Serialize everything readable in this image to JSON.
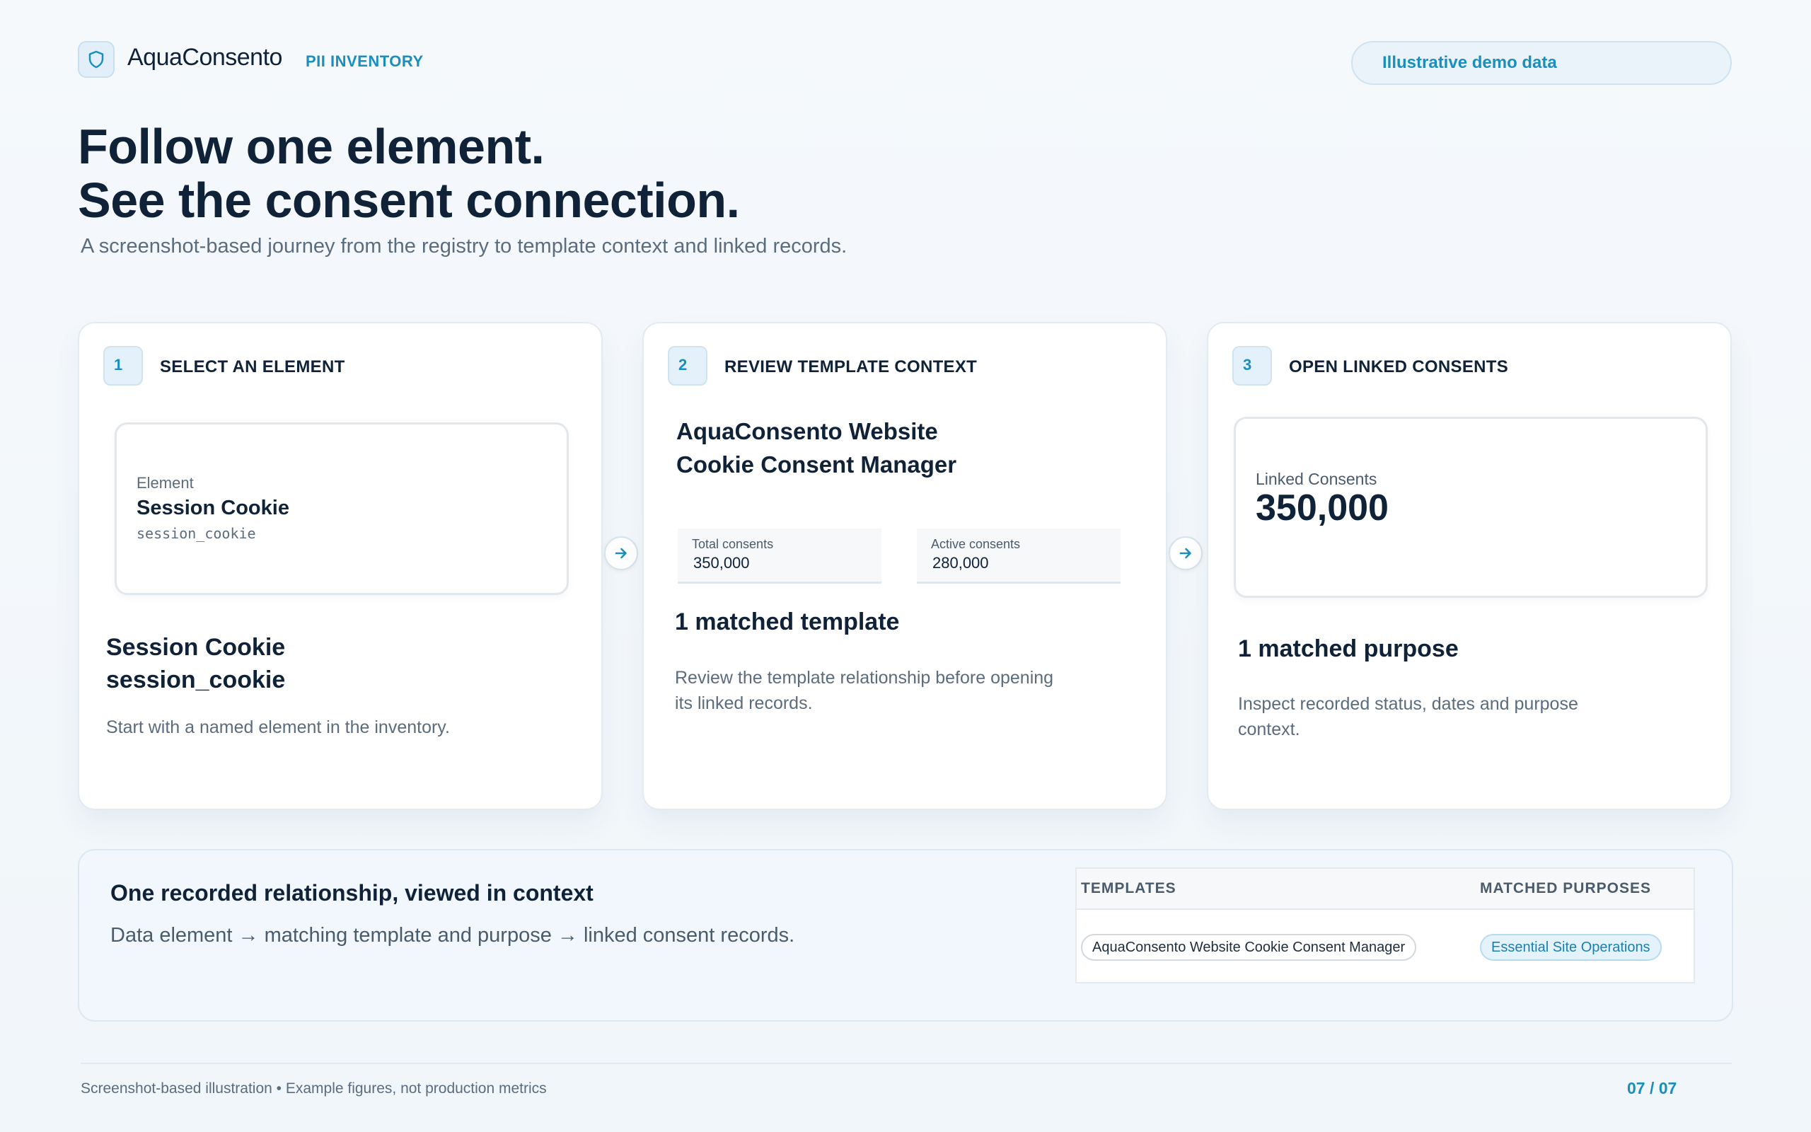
{
  "header": {
    "brand": "AquaConsento",
    "section": "PII INVENTORY",
    "demo_pill": "Illustrative demo data",
    "logo_icon": "shield-icon"
  },
  "hero": {
    "line1": "Follow one element.",
    "line2": "See the consent connection.",
    "subtitle": "A screenshot-based journey from the registry to template context and linked records."
  },
  "steps": [
    {
      "number": "1",
      "title": "SELECT AN ELEMENT",
      "preview": {
        "label": "Element",
        "name": "Session Cookie",
        "code": "session_cookie"
      },
      "heading_line1": "Session Cookie",
      "heading_line2": "session_cookie",
      "description": "Start with a named element in the inventory."
    },
    {
      "number": "2",
      "title": "REVIEW TEMPLATE CONTEXT",
      "template_line1": "AquaConsento Website",
      "template_line2": "Cookie Consent Manager",
      "stats": [
        {
          "label": "Total consents",
          "value": "350,000"
        },
        {
          "label": "Active consents",
          "value": "280,000"
        }
      ],
      "heading": "1 matched template",
      "description_line1": "Review the template relationship before opening",
      "description_line2": "its linked records."
    },
    {
      "number": "3",
      "title": "OPEN LINKED CONSENTS",
      "preview": {
        "label": "Linked Consents",
        "value": "350,000"
      },
      "heading": "1 matched purpose",
      "description_line1": "Inspect recorded status, dates and purpose",
      "description_line2": "context."
    }
  ],
  "connectors": [
    "arrow-right-icon",
    "arrow-right-icon"
  ],
  "bottom": {
    "title": "One recorded relationship, viewed in context",
    "description": "Data element → matching template and purpose → linked consent records.",
    "table": {
      "headers": [
        "TEMPLATES",
        "MATCHED PURPOSES"
      ],
      "template_chip": "AquaConsento Website Cookie Consent Manager",
      "purpose_chip": "Essential Site Operations"
    }
  },
  "footer": {
    "note": "Screenshot-based illustration • Example figures, not production metrics",
    "page": "07 / 07"
  },
  "colors": {
    "accent": "#1a8fbd",
    "heading": "#0f2238",
    "muted": "#5a6c7e"
  }
}
